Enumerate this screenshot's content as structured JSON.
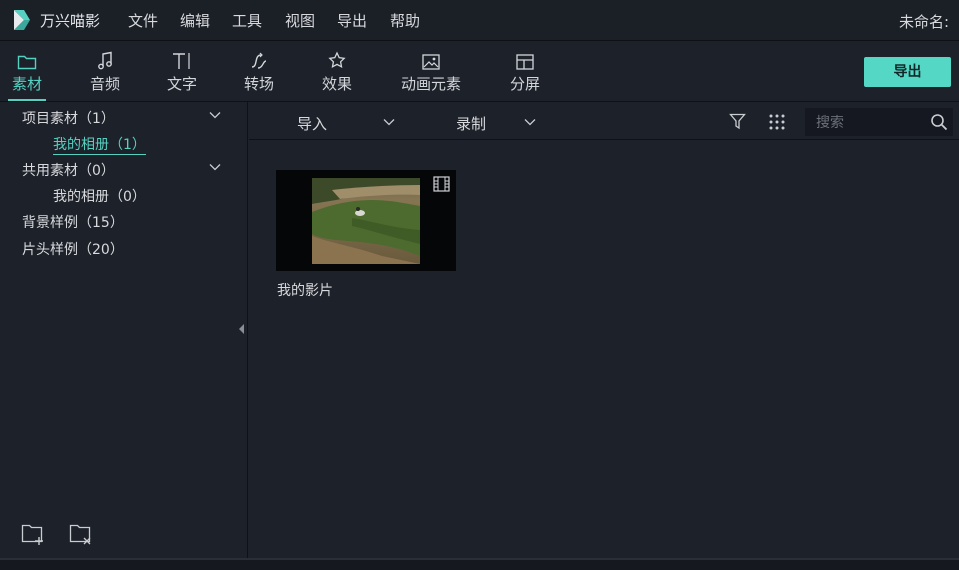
{
  "app": {
    "name": "万兴喵影",
    "project_title": "未命名:",
    "logo_icon": "filmora-logo-icon",
    "accent": "#55d1c2"
  },
  "menu": [
    "文件",
    "编辑",
    "工具",
    "视图",
    "导出",
    "帮助"
  ],
  "toolbar": {
    "tabs": [
      {
        "label": "素材",
        "icon": "folder-icon",
        "active": true
      },
      {
        "label": "音频",
        "icon": "music-note-icon"
      },
      {
        "label": "文字",
        "icon": "text-icon"
      },
      {
        "label": "转场",
        "icon": "transition-icon"
      },
      {
        "label": "效果",
        "icon": "effects-icon"
      },
      {
        "label": "动画元素",
        "icon": "image-icon"
      },
      {
        "label": "分屏",
        "icon": "split-screen-icon"
      }
    ],
    "export_label": "导出"
  },
  "sidebar": {
    "items": [
      {
        "label": "项目素材（1）",
        "expandable": true
      },
      {
        "label": "我的相册（1）",
        "selected": true
      },
      {
        "label": "共用素材（0）",
        "expandable": true
      },
      {
        "label": "我的相册（0）"
      },
      {
        "label": "背景样例（15）"
      },
      {
        "label": "片头样例（20）"
      }
    ],
    "footer_icons": [
      "new-folder-icon",
      "delete-folder-icon"
    ]
  },
  "media_toolbar": {
    "import_label": "导入",
    "record_label": "录制",
    "search_placeholder": "搜索"
  },
  "media": {
    "items": [
      {
        "label": "我的影片",
        "type": "video"
      }
    ]
  }
}
